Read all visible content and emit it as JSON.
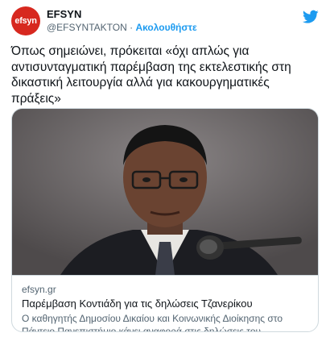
{
  "account": {
    "avatar_text": "efsyn",
    "display_name": "EFSYN",
    "handle": "@EFSYNTAKTON",
    "separator": "·",
    "follow_label": "Ακολουθήστε"
  },
  "tweet": {
    "text": "Όπως σημειώνει, πρόκειται «όχι απλώς για αντισυνταγματική παρέμβαση της εκτελεστικής στη δικαστική λειτουργία αλλά για κακουργηματικές πράξεις»"
  },
  "card": {
    "domain": "efsyn.gr",
    "title": "Παρέμβαση Κοντιάδη για τις δηλώσεις Τζανερίκου",
    "description": "Ο καθηγητής Δημοσίου Δικαίου και Κοινωνικής Διοίκησης στο Πάντειο Πανεπιστήμιο κάνει αναφορά στις δηλώσεις του αντιπροέδρου του ..."
  },
  "colors": {
    "brand_red": "#d7281f",
    "twitter_blue": "#1d9bf0",
    "secondary_text": "#536471"
  },
  "icons": {
    "platform": "twitter-bird-icon"
  }
}
